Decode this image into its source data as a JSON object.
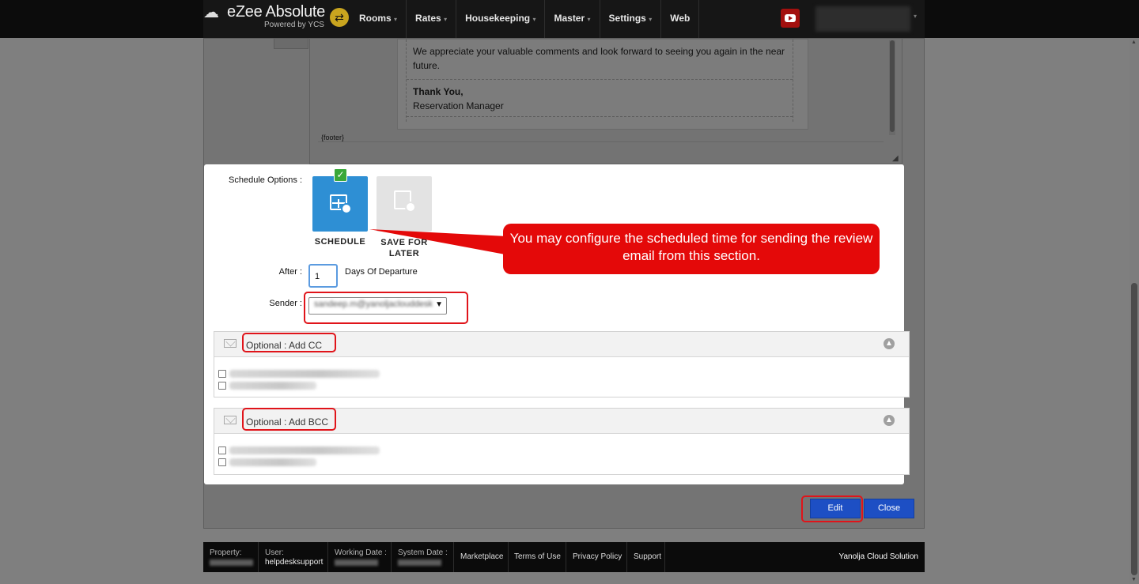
{
  "brand": {
    "title": "eZee Absolute",
    "subtitle": "Powered by YCS"
  },
  "nav": [
    {
      "label": "Rooms",
      "has_caret": true
    },
    {
      "label": "Rates",
      "has_caret": true
    },
    {
      "label": "Housekeeping",
      "has_caret": true
    },
    {
      "label": "Master",
      "has_caret": true
    },
    {
      "label": "Settings",
      "has_caret": true
    },
    {
      "label": "Web",
      "has_caret": false
    }
  ],
  "caret_glyph": "▾",
  "email_preview": {
    "line1": "We appreciate your valuable comments and look forward to seeing you again in the near future.",
    "signoff": "Thank You,",
    "signature": "Reservation Manager",
    "footer_tag": "{footer}"
  },
  "schedule": {
    "label": "Schedule Options :",
    "options": [
      {
        "label": "SCHEDULE",
        "selected": true,
        "icon": "calendar-clock-icon"
      },
      {
        "label": "SAVE FOR LATER",
        "selected": false,
        "icon": "save-clock-icon"
      }
    ],
    "after_label": "After :",
    "after_value": "1",
    "after_suffix": "Days Of Departure",
    "sender_label": "Sender :",
    "sender_value": "sandeep.m@yanoljaclouddesk"
  },
  "cc_panel": {
    "title": "Optional : Add CC"
  },
  "bcc_panel": {
    "title": "Optional : Add BCC"
  },
  "callout": {
    "text": "You may configure the scheduled time for sending the review email from this section."
  },
  "buttons": {
    "edit": "Edit",
    "close": "Close"
  },
  "footer": {
    "property_label": "Property:",
    "user_label": "User:",
    "user_value": "helpdesksupport",
    "working_date_label": "Working Date :",
    "system_date_label": "System Date :",
    "links": [
      "Marketplace",
      "Terms of Use",
      "Privacy Policy",
      "Support"
    ],
    "brand": "Yanolja Cloud Solution"
  },
  "colors": {
    "accent_blue": "#1d4fc4",
    "tile_blue": "#2e8fd4",
    "callout_red": "#e40909",
    "check_green": "#3aa83a"
  }
}
